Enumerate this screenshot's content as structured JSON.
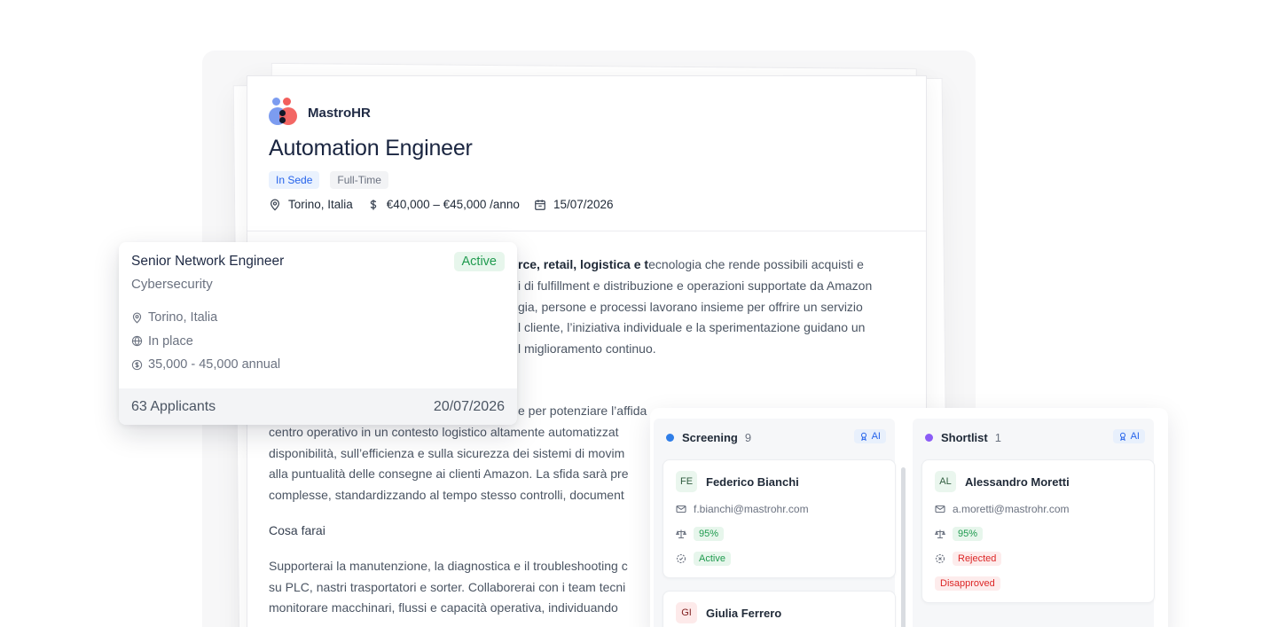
{
  "job": {
    "brand": "MastroHR",
    "title": "Automation Engineer",
    "chips": [
      "In Sede",
      "Full-Time"
    ],
    "location": "Torino, Italia",
    "salary": "€40,000 – €45,000 /anno",
    "date": "15/07/2026",
    "body": {
      "p1_bold": "rce, retail, logistica e t",
      "p1_rest": "ecnologia che rende possibili acquisti e",
      "p1_lines": [
        "i di fulfillment e distribuzione e operazioni supportate da Amazon",
        "gia, persone e processi lavorano insieme per offrire un servizio",
        "l cliente, l’iniziativa individuale e la sperimentazione guidano un",
        "l miglioramento continuo."
      ],
      "p2_lines": [
        "e per potenziare l’affida",
        "centro operativo in un contesto logistico altamente automatizzat",
        "disponibilità, sull’efficienza e sulla sicurezza dei sistemi di movim",
        "alla puntualità delle consegne ai clienti Amazon. La sfida sarà pre",
        "complesse, standardizzando al tempo stesso controlli, document"
      ],
      "heading": "Cosa farai",
      "p3_lines": [
        "Supporterai la manutenzione, la diagnostica e il troubleshooting c",
        "su PLC, nastri trasportatori e sorter. Collaborerai con i team tecni",
        "monitorare macchinari, flussi e capacità operativa, individuando"
      ]
    }
  },
  "floating_card": {
    "title": "Senior Network Engineer",
    "subtitle": "Cybersecurity",
    "status": "Active",
    "location": "Torino, Italia",
    "workplace": "In place",
    "salary": "35,000 - 45,000 annual",
    "applicants": "63 Applicants",
    "date": "20/07/2026"
  },
  "kanban": {
    "columns": [
      {
        "name": "Screening",
        "count": "9",
        "color": "#2f7ee8",
        "ai_label": "AI",
        "candidates": [
          {
            "initials": "FE",
            "name": "Federico Bianchi",
            "email": "f.bianchi@mastrohr.com",
            "score": "95%",
            "status": "Active"
          },
          {
            "initials": "GI",
            "name": "Giulia Ferrero"
          }
        ]
      },
      {
        "name": "Shortlist",
        "count": "1",
        "color": "#8b5cf6",
        "ai_label": "AI",
        "candidates": [
          {
            "initials": "AL",
            "name": "Alessandro Moretti",
            "email": "a.moretti@mastrohr.com",
            "score": "95%",
            "status": "Rejected",
            "decision": "Disapproved"
          }
        ]
      }
    ]
  }
}
